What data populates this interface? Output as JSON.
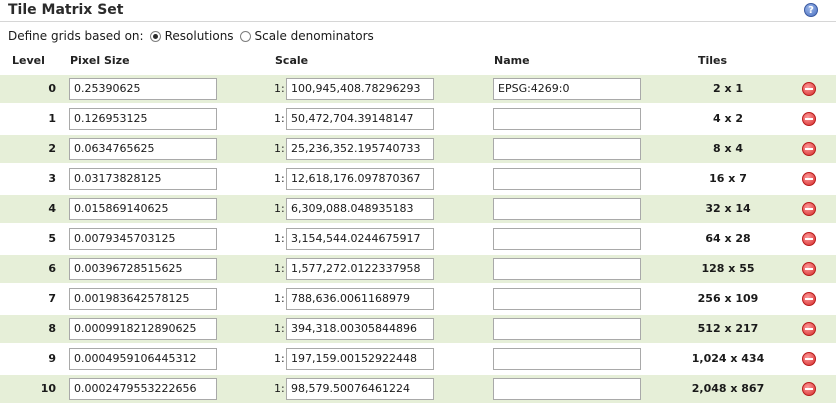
{
  "header": {
    "title": "Tile Matrix Set",
    "help_icon": "help-icon",
    "help_glyph": "?"
  },
  "define": {
    "label": "Define grids based on:",
    "options": [
      {
        "label": "Resolutions",
        "selected": true
      },
      {
        "label": "Scale denominators",
        "selected": false
      }
    ]
  },
  "columns": {
    "level": "Level",
    "pixel_size": "Pixel Size",
    "scale": "Scale",
    "name": "Name",
    "tiles": "Tiles"
  },
  "scale_prefix": "1:",
  "rows": [
    {
      "level": "0",
      "pixel_size": "0.25390625",
      "scale": "100,945,408.78296293",
      "name": "EPSG:4269:0",
      "tiles": "2 x 1"
    },
    {
      "level": "1",
      "pixel_size": "0.126953125",
      "scale": "50,472,704.39148147",
      "name": "",
      "tiles": "4 x 2"
    },
    {
      "level": "2",
      "pixel_size": "0.0634765625",
      "scale": "25,236,352.195740733",
      "name": "",
      "tiles": "8 x 4"
    },
    {
      "level": "3",
      "pixel_size": "0.03173828125",
      "scale": "12,618,176.097870367",
      "name": "",
      "tiles": "16 x 7"
    },
    {
      "level": "4",
      "pixel_size": "0.015869140625",
      "scale": "6,309,088.048935183",
      "name": "",
      "tiles": "32 x 14"
    },
    {
      "level": "5",
      "pixel_size": "0.0079345703125",
      "scale": "3,154,544.0244675917",
      "name": "",
      "tiles": "64 x 28"
    },
    {
      "level": "6",
      "pixel_size": "0.00396728515625",
      "scale": "1,577,272.0122337958",
      "name": "",
      "tiles": "128 x 55"
    },
    {
      "level": "7",
      "pixel_size": "0.001983642578125",
      "scale": "788,636.0061168979",
      "name": "",
      "tiles": "256 x 109"
    },
    {
      "level": "8",
      "pixel_size": "0.0009918212890625",
      "scale": "394,318.00305844896",
      "name": "",
      "tiles": "512 x 217"
    },
    {
      "level": "9",
      "pixel_size": "0.0004959106445312",
      "scale": "197,159.00152922448",
      "name": "",
      "tiles": "1,024 x 434"
    },
    {
      "level": "10",
      "pixel_size": "0.0002479553222656",
      "scale": "98,579.50076461224",
      "name": "",
      "tiles": "2,048 x 867"
    }
  ],
  "row_icon": "remove-icon",
  "colors": {
    "row_alt": "#e6efd8",
    "remove": "#d42a2a",
    "help": "#4a6fc0"
  }
}
